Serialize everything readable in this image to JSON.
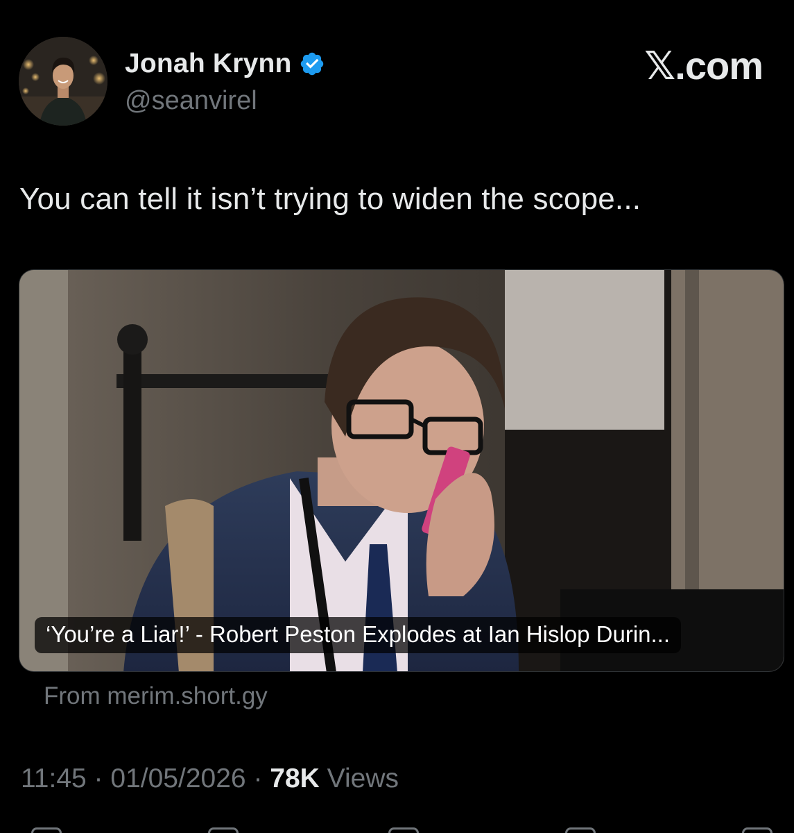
{
  "author": {
    "display_name": "Jonah Krynn",
    "handle": "@seanvirel",
    "verified": true,
    "avatar_icon": "profile-photo"
  },
  "brand": {
    "label": "𝕏.com"
  },
  "tweet": {
    "text": "You can tell it isn’t trying to widen the scope..."
  },
  "link_card": {
    "title": "‘You’re a Liar!’ - Robert Peston Explodes at Ian Hislop Durin...",
    "source": "From merim.short.gy"
  },
  "meta": {
    "time": "11:45",
    "separator": "·",
    "date": "01/05/2026",
    "views_count": "78K",
    "views_label": "Views"
  },
  "colors": {
    "background": "#000000",
    "primary_text": "#e7e9ea",
    "secondary_text": "#71767b",
    "verified_blue": "#1d9bf0"
  }
}
